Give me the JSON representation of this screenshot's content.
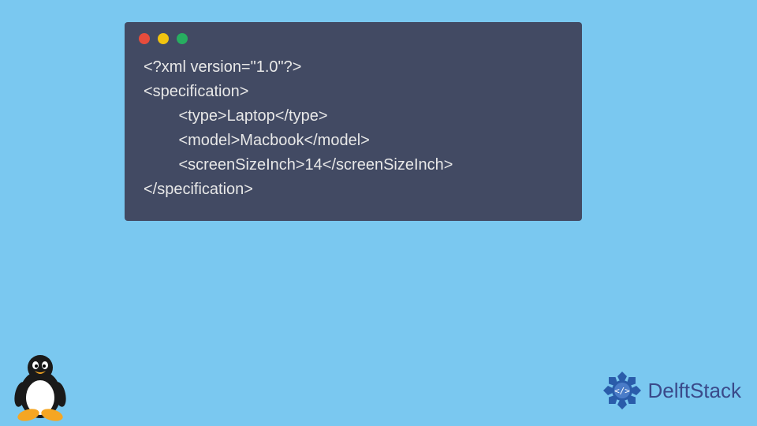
{
  "code": {
    "line1": "<?xml version=\"1.0\"?>",
    "line2": "<specification>",
    "line3": "        <type>Laptop</type>",
    "line4": "        <model>Macbook</model>",
    "line5": "        <screenSizeInch>14</screenSizeInch>",
    "line6": "</specification>"
  },
  "brand": {
    "name": "DelftStack"
  },
  "colors": {
    "bg": "#7ac8f0",
    "window": "#424a63",
    "red": "#e74c3c",
    "yellow": "#f1c40f",
    "green": "#27ae60"
  }
}
